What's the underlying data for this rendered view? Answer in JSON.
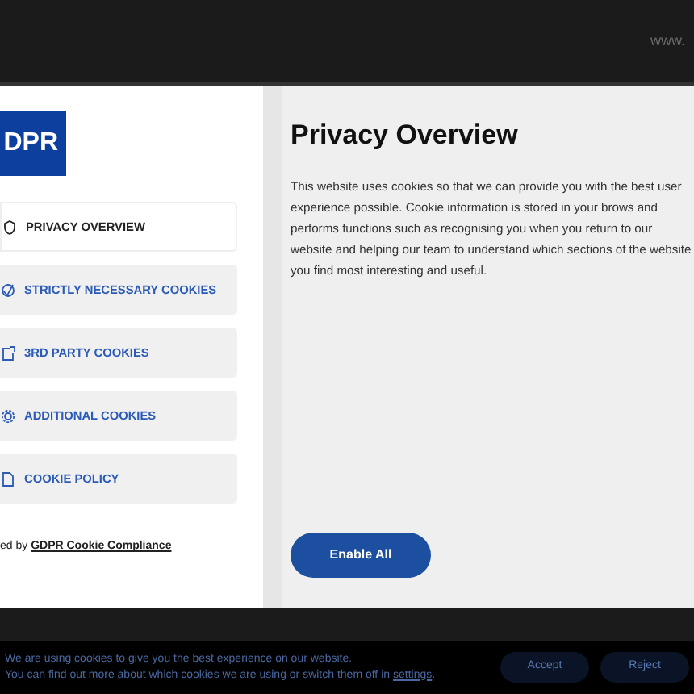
{
  "backdrop": {
    "url_text": "www."
  },
  "modal": {
    "logo": "DPR",
    "menu": [
      {
        "label": "PRIVACY OVERVIEW",
        "selected": true,
        "kind": "shield"
      },
      {
        "label": "STRICTLY NECESSARY COOKIES",
        "selected": false,
        "kind": "check"
      },
      {
        "label": "3RD PARTY COOKIES",
        "selected": false,
        "kind": "box"
      },
      {
        "label": "ADDITIONAL COOKIES",
        "selected": false,
        "kind": "gear"
      },
      {
        "label": "COOKIE POLICY",
        "selected": false,
        "kind": "doc"
      }
    ],
    "powered_by": {
      "text": "ed by",
      "link": "GDPR Cookie Compliance"
    },
    "title": "Privacy Overview",
    "body": "This website uses cookies so that we can provide you with the best user experience possible. Cookie information is stored in your brows and performs functions such as recognising you when you return to our website and helping our team to understand which sections of the website you find most interesting and useful.",
    "enable_button": "Enable All"
  },
  "cookie_bar": {
    "line_1": "We are using cookies to give you the best experience on our website.",
    "line_2": "You can find out more about which cookies we are using or switch them off in",
    "settings_link": "settings",
    "line_2_end": ".",
    "buttons": [
      "Accept",
      "Reject"
    ]
  }
}
